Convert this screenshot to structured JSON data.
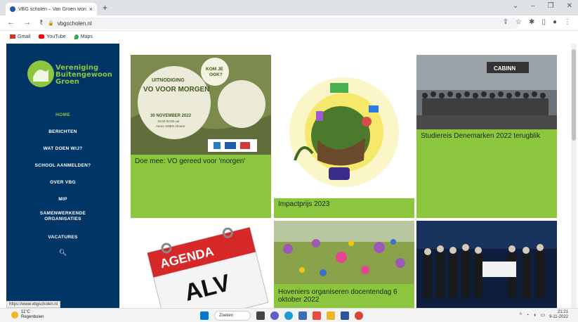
{
  "browser": {
    "tab_title": "VBG scholen – Van Groen word ...",
    "url": "vbgscholen.nl",
    "bookmarks": [
      "Gmail",
      "YouTube",
      "Maps"
    ]
  },
  "site": {
    "logo_text": [
      "Vereniging",
      "Buitengewoon",
      "Groen"
    ],
    "menu": {
      "home": "HOME",
      "berichten": "BERICHTEN",
      "wat_doen_wij": "WAT DOEN WIJ?",
      "school_aanmelden": "SCHOOL AANMELDEN?",
      "over_vbg": "OVER VBG",
      "mip": "MIP",
      "samenwerkende_1": "SAMENWERKENDE",
      "samenwerkende_2": "ORGANISATIES",
      "vacatures": "VACATURES"
    },
    "cards": {
      "card1": {
        "caption": "Doe mee: VO gereed voor 'morgen'",
        "poster": {
          "invite": "UITNODIGING",
          "headline": "VO VOOR MORGEN",
          "date": "30 NOVEMBER 2022",
          "time": "15:00-20:00 uur",
          "place": "Aeres VMBO Almere",
          "bubble_line1": "KOM JE",
          "bubble_line2": "OOK?"
        }
      },
      "card2": {
        "caption": "Impactprijs 2023"
      },
      "card3": {
        "caption": "Studiereis Denemarken 2022 terugblik",
        "sign": "CABINN"
      },
      "card4": {
        "caption": "",
        "agenda": "AGENDA",
        "alv": "ALV"
      },
      "card5": {
        "caption_line1": "Hoveniers organiseren docentendag 6",
        "caption_line2": "oktober 2022"
      },
      "card6": {
        "caption": ""
      }
    },
    "status_url": "https://www.vbgscholen.nl"
  },
  "taskbar": {
    "temp": "11°C",
    "weather_desc": "Regenbuien",
    "search_label": "Zoeken",
    "time": "21:21",
    "date": "9-11-2022"
  },
  "colors": {
    "sidebar": "#003566",
    "accent_green": "#8cc63f"
  }
}
